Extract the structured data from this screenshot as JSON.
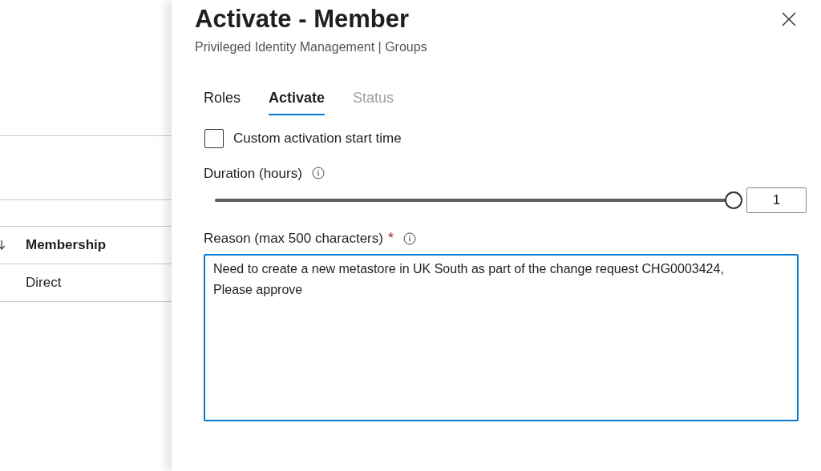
{
  "background": {
    "rows": [
      {
        "label": "Membership",
        "bold": true,
        "sort_arrow": true
      },
      {
        "label": "Direct",
        "bold": false,
        "sort_arrow": false
      }
    ]
  },
  "panel": {
    "title": "Activate - Member",
    "subtitle": "Privileged Identity Management | Groups",
    "tabs": [
      {
        "label": "Roles",
        "selected": false,
        "disabled": false
      },
      {
        "label": "Activate",
        "selected": true,
        "disabled": false
      },
      {
        "label": "Status",
        "selected": false,
        "disabled": true
      }
    ],
    "custom_start": {
      "label": "Custom activation start time",
      "checked": false
    },
    "duration": {
      "label": "Duration (hours)",
      "level": 1,
      "value": "1"
    },
    "reason": {
      "label": "Reason (max 500 characters)",
      "required_mark": "*",
      "value": "Need to create a new metastore in UK South as part of the change request CHG0003424, Please approve"
    }
  }
}
